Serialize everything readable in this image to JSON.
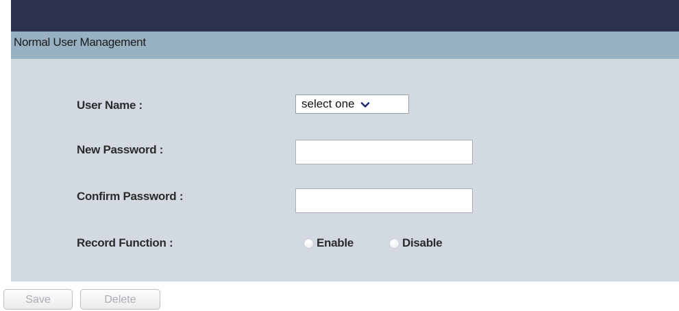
{
  "header": {
    "title": "Normal User Management"
  },
  "form": {
    "user_name_label": "User Name :",
    "user_name_select": {
      "selected": "select one"
    },
    "new_password_label": "New Password :",
    "new_password_value": "",
    "confirm_password_label": "Confirm Password :",
    "confirm_password_value": "",
    "record_function_label": "Record Function :",
    "record_options": {
      "enable": "Enable",
      "disable": "Disable",
      "selected": null
    }
  },
  "buttons": {
    "save": "Save",
    "delete": "Delete"
  },
  "colors": {
    "top_bar": "#2e3150",
    "header_bg": "#98b1c2",
    "panel_bg": "#d3d9e1"
  },
  "icons": {
    "select_arrow": "chevron-down-icon"
  }
}
